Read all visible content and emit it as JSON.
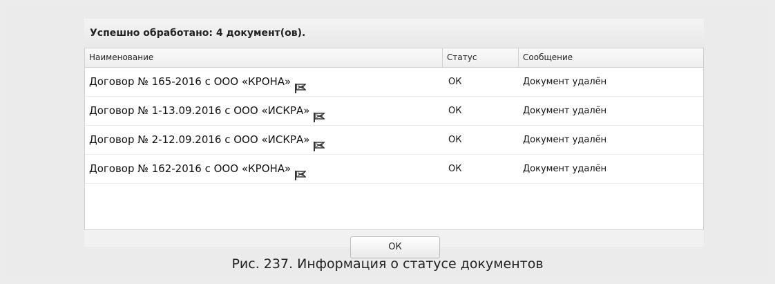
{
  "dialog": {
    "title": "Успешно обработано: 4 документ(ов).",
    "columns": [
      "Наименование",
      "Статус",
      "Сообщение"
    ],
    "rows": [
      {
        "name": "Договор № 165-2016 с ООО «КРОНА»",
        "status": "ОК",
        "message": "Документ удалён",
        "icon": "flag-icon"
      },
      {
        "name": "Договор № 1-13.09.2016 с ООО «ИСКРА»",
        "status": "ОК",
        "message": "Документ удалён",
        "icon": "flag-icon"
      },
      {
        "name": "Договор № 2-12.09.2016 с ООО «ИСКРА»",
        "status": "ОК",
        "message": "Документ удалён",
        "icon": "flag-icon"
      },
      {
        "name": "Договор № 162-2016 с ООО «КРОНА»",
        "status": "ОК",
        "message": "Документ удалён",
        "icon": "flag-icon"
      }
    ],
    "ok_label": "ОК"
  },
  "caption": "Рис. 237. Информация о статусе документов",
  "colors": {
    "background": "#ececec",
    "dialog_bg": "#f1f1f1",
    "grid_bg": "#ffffff",
    "border": "#d0d0d0"
  }
}
